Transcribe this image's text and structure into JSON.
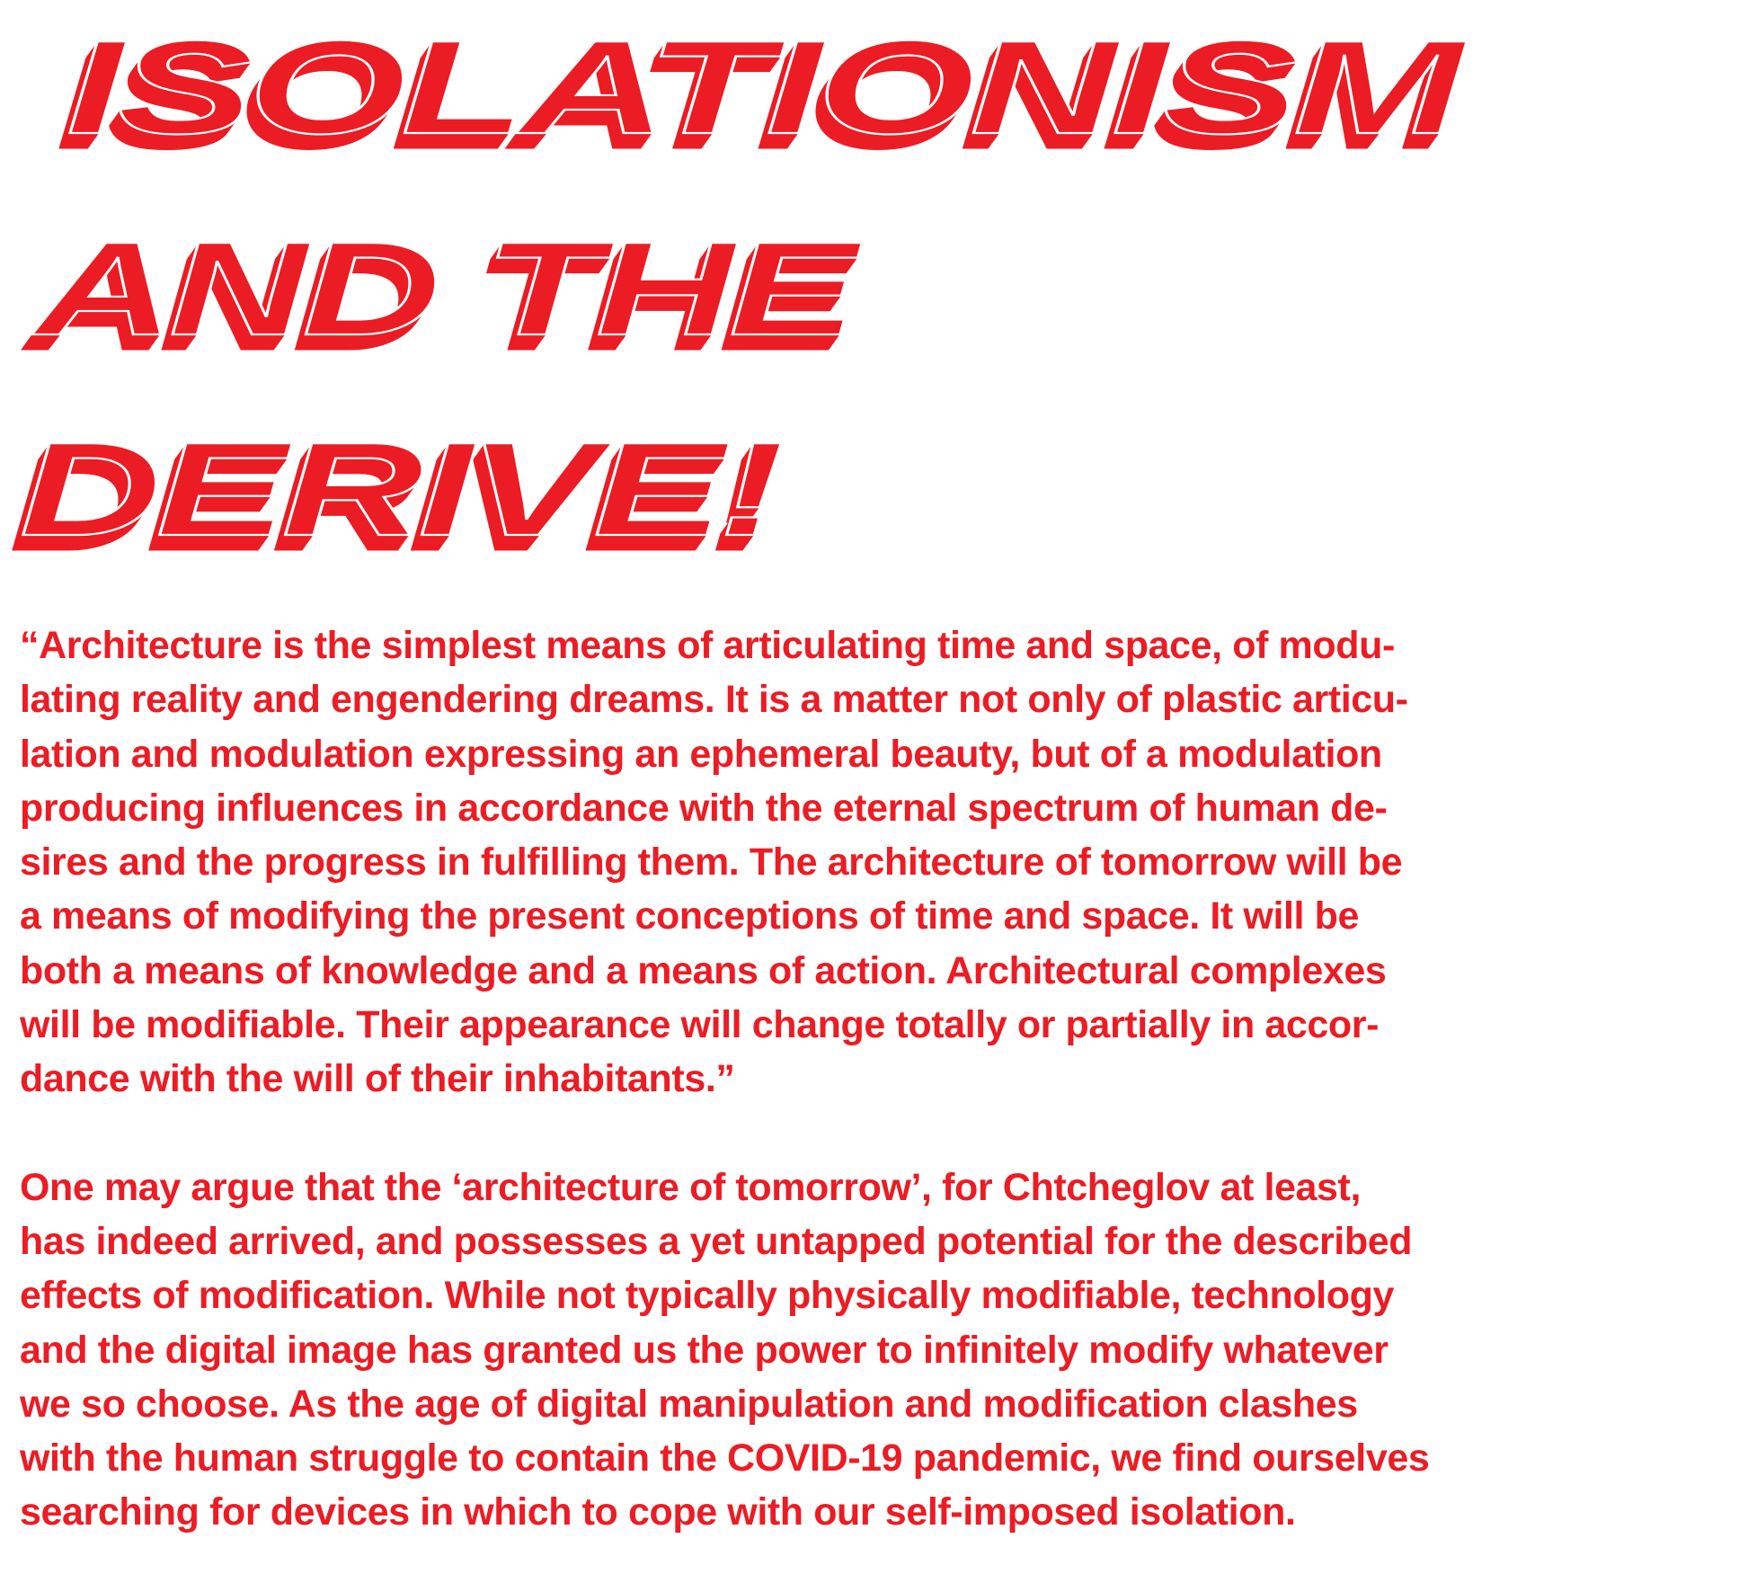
{
  "colors": {
    "accent": "#ec1c24",
    "background": "#ffffff"
  },
  "title": {
    "lines": [
      "ISOLATIONISM",
      "AND THE",
      "DERIVE!"
    ]
  },
  "paragraphs": [
    {
      "lines": [
        "“Architecture is the simplest means of articulating time and space, of modu-",
        "lating reality and engendering dreams. It is a matter not only of plastic articu-",
        "lation and modulation expressing an ephemeral beauty, but of a modulation",
        "producing influences in accordance with the eternal spectrum of human de-",
        "sires and the progress in fulfilling them. The architecture of tomorrow will be",
        "a means of modifying the present conceptions of time and space. It will be",
        "both a means of knowledge and a means of action. Architectural complexes",
        "will be modifiable. Their appearance will change totally or partially in accor-",
        "dance with the will of their inhabitants.”"
      ]
    },
    {
      "lines": [
        "One may argue that the ‘architecture of tomorrow’, for Chtcheglov at least,",
        "has indeed arrived, and possesses a yet untapped potential for the described",
        "effects of modification. While not typically physically modifiable, technology",
        "and the digital image has granted us the power to infinitely modify whatever",
        "we so choose. As the age of digital manipulation and modification clashes",
        "with the human struggle to contain the COVID-19 pandemic, we find ourselves",
        "searching for devices in which to cope with our self-imposed isolation."
      ]
    }
  ]
}
